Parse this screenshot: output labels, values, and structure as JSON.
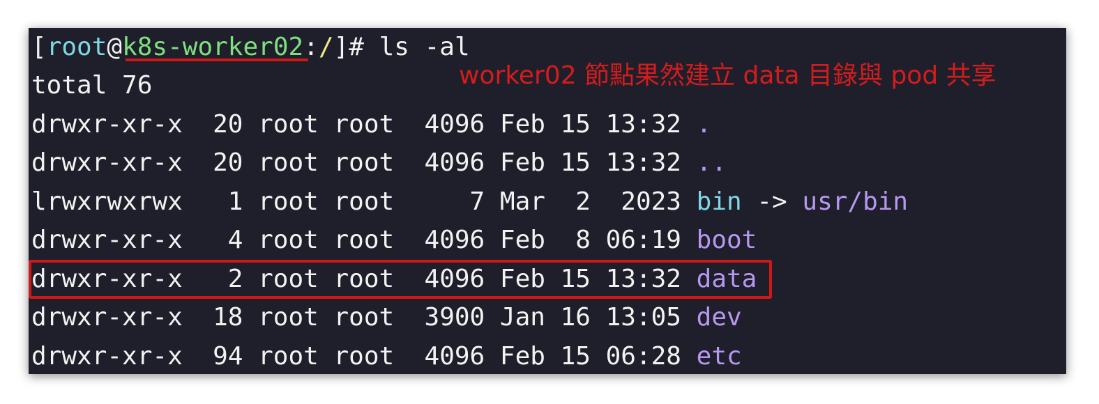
{
  "prompt": {
    "open_bracket": "[",
    "user": "root",
    "at": "@",
    "host": "k8s-worker02",
    "colon": ":",
    "path": "/",
    "close": "]# ",
    "command": "ls -al"
  },
  "total_line": "total 76",
  "annotation": "worker02 節點果然建立 data 目錄與 pod 共享",
  "listing": [
    {
      "meta": "drwxr-xr-x  20 root root  4096 Feb 15 13:32 ",
      "name": ".",
      "arrow": "",
      "target": ""
    },
    {
      "meta": "drwxr-xr-x  20 root root  4096 Feb 15 13:32 ",
      "name": "..",
      "arrow": "",
      "target": ""
    },
    {
      "meta": "lrwxrwxrwx   1 root root     7 Mar  2  2023 ",
      "name": "bin",
      "arrow": " -> ",
      "target": "usr/bin"
    },
    {
      "meta": "drwxr-xr-x   4 root root  4096 Feb  8 06:19 ",
      "name": "boot",
      "arrow": "",
      "target": ""
    },
    {
      "meta": "drwxr-xr-x   2 root root  4096 Feb 15 13:32 ",
      "name": "data",
      "arrow": "",
      "target": ""
    },
    {
      "meta": "drwxr-xr-x  18 root root  3900 Jan 16 13:05 ",
      "name": "dev",
      "arrow": "",
      "target": ""
    },
    {
      "meta": "drwxr-xr-x  94 root root  4096 Feb 15 06:28 ",
      "name": "etc",
      "arrow": "",
      "target": ""
    }
  ],
  "colors": {
    "background": "#1f1f2b",
    "text": "#f2f2f2",
    "user": "#7fd7e6",
    "host": "#7fe07f",
    "path": "#f2e58a",
    "directory": "#b897f0",
    "symlink": "#7fd7e6",
    "annotation": "#d51c1c"
  }
}
